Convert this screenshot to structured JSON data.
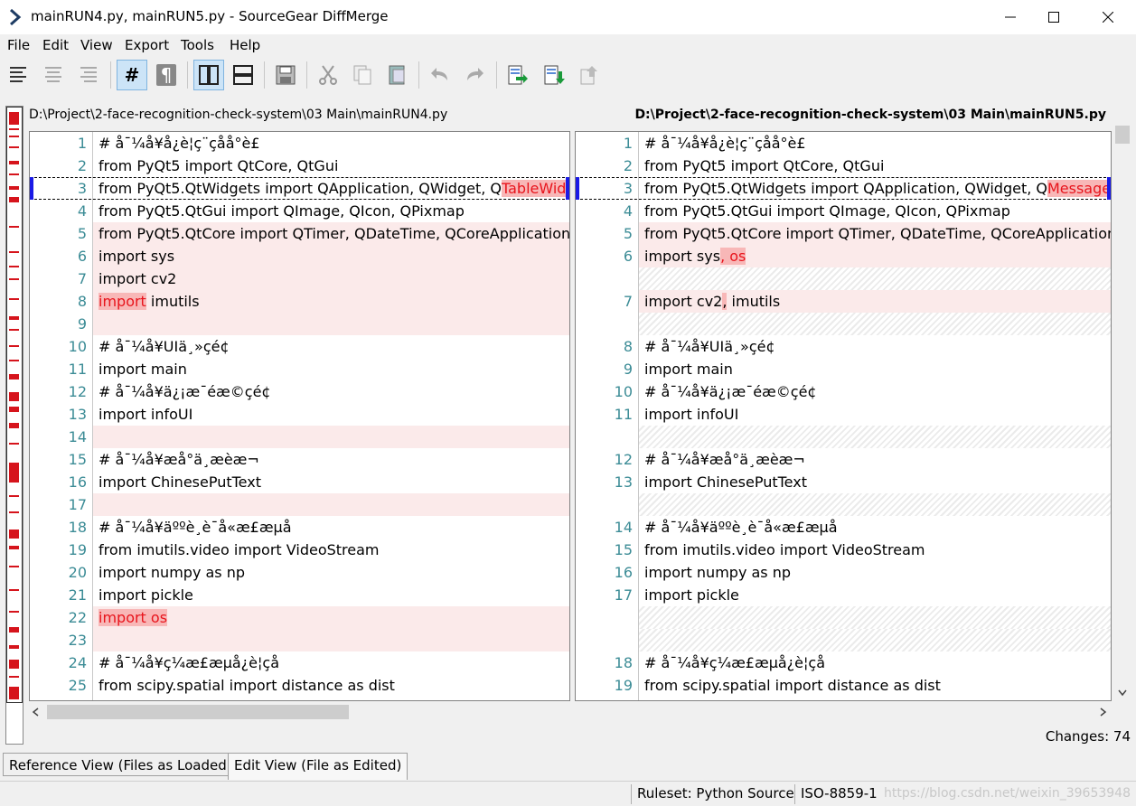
{
  "window": {
    "title": "mainRUN4.py, mainRUN5.py - SourceGear DiffMerge",
    "controls": [
      "minimize-icon",
      "maximize-icon",
      "close-icon"
    ]
  },
  "menu": [
    "File",
    "Edit",
    "View",
    "Export",
    "Tools",
    "Help"
  ],
  "toolbar": {
    "hash_label": "#",
    "pilcrow_label": "¶",
    "icons": [
      "align-left-icon",
      "align-center-icon",
      "align-right-icon",
      "line-numbers-icon",
      "pilcrow-icon",
      "split-vertical-icon",
      "split-horizontal-icon",
      "save-icon",
      "cut-icon",
      "copy-icon",
      "paste-icon",
      "undo-icon",
      "redo-icon",
      "next-change-icon",
      "prev-change-icon",
      "export-icon"
    ]
  },
  "paths": {
    "left": "D:\\Project\\2-face-recognition-check-system\\03 Main\\mainRUN4.py",
    "right": "D:\\Project\\2-face-recognition-check-system\\03 Main\\mainRUN5.py"
  },
  "left_pane": {
    "lines": [
      {
        "num": "1",
        "text": "# å¯¼å¥å¿è¦ç¨çåå°è£",
        "state": "normal"
      },
      {
        "num": "2",
        "text": "from PyQt5 import QtCore, QtGui",
        "state": "normal"
      },
      {
        "num": "3",
        "text": "from PyQt5.QtWidgets import QApplication, QWidget, Q",
        "hl": "TableWidge",
        "state": "current"
      },
      {
        "num": "4",
        "text": "from PyQt5.QtGui import QImage, QIcon, QPixmap",
        "state": "normal"
      },
      {
        "num": "5",
        "text": "from PyQt5.QtCore import QTimer, QDateTime, QCoreApplication, QT",
        "state": "changed"
      },
      {
        "num": "6",
        "text": "import sys",
        "state": "changed"
      },
      {
        "num": "7",
        "text": "import cv2",
        "state": "changed"
      },
      {
        "num": "8",
        "text": " imutils",
        "hl_pre": "import",
        "state": "changed"
      },
      {
        "num": "9",
        "text": "",
        "state": "changed"
      },
      {
        "num": "10",
        "text": "# å¯¼å¥UIä¸»çé¢",
        "state": "normal"
      },
      {
        "num": "11",
        "text": "import main",
        "state": "normal"
      },
      {
        "num": "12",
        "text": "# å¯¼å¥ä¿¡æ¯éæ©çé¢",
        "state": "normal"
      },
      {
        "num": "13",
        "text": "import infoUI",
        "state": "normal"
      },
      {
        "num": "14",
        "text": "",
        "state": "changed"
      },
      {
        "num": "15",
        "text": "# å¯¼å¥æå°ä¸­æèæ¬",
        "state": "normal"
      },
      {
        "num": "16",
        "text": "import ChinesePutText",
        "state": "normal"
      },
      {
        "num": "17",
        "text": "",
        "state": "changed"
      },
      {
        "num": "18",
        "text": "# å¯¼å¥äººè¸è¯å«æ£æµå",
        "state": "normal"
      },
      {
        "num": "19",
        "text": "from imutils.video import VideoStream",
        "state": "normal"
      },
      {
        "num": "20",
        "text": "import numpy as np",
        "state": "normal"
      },
      {
        "num": "21",
        "text": "import pickle",
        "state": "normal"
      },
      {
        "num": "22",
        "text": "",
        "hl_pre": "import os",
        "state": "changed"
      },
      {
        "num": "23",
        "text": "",
        "state": "changed"
      },
      {
        "num": "24",
        "text": "# å¯¼å¥ç¼æ£æµå¿è¦çå",
        "state": "normal"
      },
      {
        "num": "25",
        "text": "from scipy.spatial import distance as dist",
        "state": "normal"
      }
    ]
  },
  "right_pane": {
    "lines": [
      {
        "num": "1",
        "text": "# å¯¼å¥å¿è¦ç¨çåå°è£",
        "state": "normal"
      },
      {
        "num": "2",
        "text": "from PyQt5 import QtCore, QtGui",
        "state": "normal"
      },
      {
        "num": "3",
        "text": "from PyQt5.QtWidgets import QApplication, QWidget, Q",
        "hl": "MessageBo",
        "state": "current"
      },
      {
        "num": "4",
        "text": "from PyQt5.QtGui import QImage, QIcon, QPixmap",
        "state": "normal"
      },
      {
        "num": "5",
        "text": "from PyQt5.QtCore import QTimer, QDateTime, QCoreApplication, Q",
        "state": "changed"
      },
      {
        "num": "6",
        "text": "import sys",
        "hl": ", os",
        "state": "changed"
      },
      {
        "num": "",
        "text": "",
        "state": "gap"
      },
      {
        "num": "7",
        "text": "import cv2",
        "hl_nocol": ",",
        "tail": " imutils",
        "state": "changed"
      },
      {
        "num": "",
        "text": "",
        "state": "gap"
      },
      {
        "num": "8",
        "text": "# å¯¼å¥UIä¸»çé¢",
        "state": "normal"
      },
      {
        "num": "9",
        "text": "import main",
        "state": "normal"
      },
      {
        "num": "10",
        "text": "# å¯¼å¥ä¿¡æ¯éæ©çé¢",
        "state": "normal"
      },
      {
        "num": "11",
        "text": "import infoUI",
        "state": "normal"
      },
      {
        "num": "",
        "text": "",
        "state": "gap"
      },
      {
        "num": "12",
        "text": "# å¯¼å¥æå°ä¸­æèæ¬",
        "state": "normal"
      },
      {
        "num": "13",
        "text": "import ChinesePutText",
        "state": "normal"
      },
      {
        "num": "",
        "text": "",
        "state": "gap"
      },
      {
        "num": "14",
        "text": "# å¯¼å¥äººè¸è¯å«æ£æµå",
        "state": "normal"
      },
      {
        "num": "15",
        "text": "from imutils.video import VideoStream",
        "state": "normal"
      },
      {
        "num": "16",
        "text": "import numpy as np",
        "state": "normal"
      },
      {
        "num": "17",
        "text": "import pickle",
        "state": "normal"
      },
      {
        "num": "",
        "text": "",
        "state": "gap"
      },
      {
        "num": "",
        "text": "",
        "state": "gap"
      },
      {
        "num": "18",
        "text": "# å¯¼å¥ç¼æ£æµå¿è¦çå",
        "state": "normal"
      },
      {
        "num": "19",
        "text": "from scipy.spatial import distance as dist",
        "state": "normal"
      }
    ]
  },
  "changes_label": "Changes: 74",
  "tabs": {
    "reference": "Reference View (Files as Loaded)",
    "edit": "Edit View (File as Edited)"
  },
  "status": {
    "ruleset": "Ruleset: Python Source",
    "encoding": "ISO-8859-1",
    "watermark": "https://blog.csdn.net/weixin_39653948"
  }
}
